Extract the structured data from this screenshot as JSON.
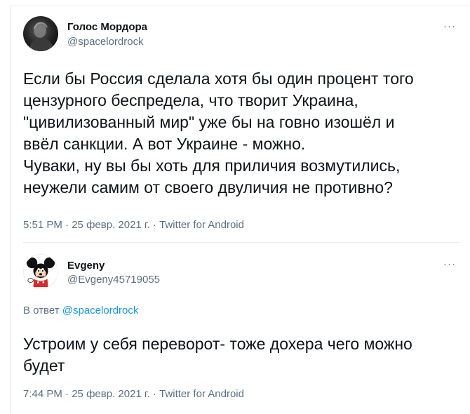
{
  "tweet1": {
    "author_name": "Голос Мордора",
    "author_handle": "@spacelordrock",
    "more_label": "···",
    "text": "Если бы Россия сделала хотя бы один процент того\nцензурного беспредела, что творит Украина,\n\"цивилизованный мир\" уже бы на говно изошёл и\nввёл санкции. А вот Украине - можно.\nЧуваки, ну вы бы хоть для приличия возмутились,\nнеужели самим от своего двуличия не противно?",
    "time": "5:51 PM",
    "separator": " · ",
    "date": "25 февр. 2021 г.",
    "source": "Twitter for Android"
  },
  "tweet2": {
    "author_name": "Evgeny",
    "author_handle": "@Evgeny45719055",
    "more_label": "···",
    "reply_prefix": "В ответ ",
    "reply_mention": "@spacelordrock",
    "text": "Устроим у себя переворот- тоже дохера чего можно\nбудет",
    "time": "7:44 PM",
    "separator": " · ",
    "date": "25 февр. 2021 г.",
    "source": "Twitter for Android"
  },
  "colors": {
    "text": "#0f1419",
    "secondary": "#5b7083",
    "link": "#1b95e0",
    "divider": "#e6ecf0"
  }
}
